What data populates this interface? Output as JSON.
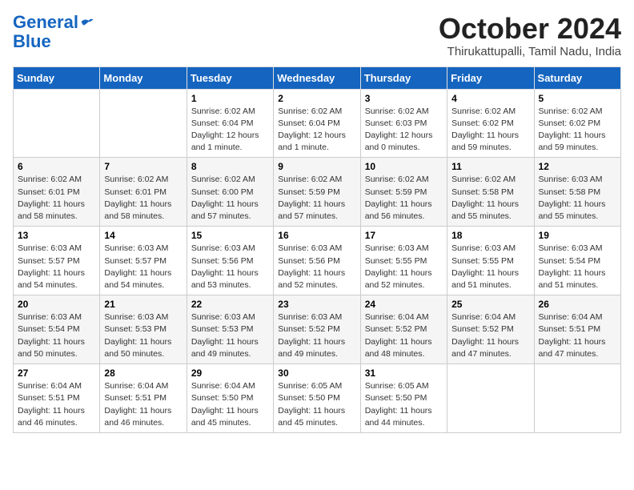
{
  "header": {
    "logo_line1": "General",
    "logo_line2": "Blue",
    "month": "October 2024",
    "location": "Thirukattupalli, Tamil Nadu, India"
  },
  "columns": [
    "Sunday",
    "Monday",
    "Tuesday",
    "Wednesday",
    "Thursday",
    "Friday",
    "Saturday"
  ],
  "weeks": [
    [
      {
        "day": "",
        "info": ""
      },
      {
        "day": "",
        "info": ""
      },
      {
        "day": "1",
        "info": "Sunrise: 6:02 AM\nSunset: 6:04 PM\nDaylight: 12 hours and 1 minute."
      },
      {
        "day": "2",
        "info": "Sunrise: 6:02 AM\nSunset: 6:04 PM\nDaylight: 12 hours and 1 minute."
      },
      {
        "day": "3",
        "info": "Sunrise: 6:02 AM\nSunset: 6:03 PM\nDaylight: 12 hours and 0 minutes."
      },
      {
        "day": "4",
        "info": "Sunrise: 6:02 AM\nSunset: 6:02 PM\nDaylight: 11 hours and 59 minutes."
      },
      {
        "day": "5",
        "info": "Sunrise: 6:02 AM\nSunset: 6:02 PM\nDaylight: 11 hours and 59 minutes."
      }
    ],
    [
      {
        "day": "6",
        "info": "Sunrise: 6:02 AM\nSunset: 6:01 PM\nDaylight: 11 hours and 58 minutes."
      },
      {
        "day": "7",
        "info": "Sunrise: 6:02 AM\nSunset: 6:01 PM\nDaylight: 11 hours and 58 minutes."
      },
      {
        "day": "8",
        "info": "Sunrise: 6:02 AM\nSunset: 6:00 PM\nDaylight: 11 hours and 57 minutes."
      },
      {
        "day": "9",
        "info": "Sunrise: 6:02 AM\nSunset: 5:59 PM\nDaylight: 11 hours and 57 minutes."
      },
      {
        "day": "10",
        "info": "Sunrise: 6:02 AM\nSunset: 5:59 PM\nDaylight: 11 hours and 56 minutes."
      },
      {
        "day": "11",
        "info": "Sunrise: 6:02 AM\nSunset: 5:58 PM\nDaylight: 11 hours and 55 minutes."
      },
      {
        "day": "12",
        "info": "Sunrise: 6:03 AM\nSunset: 5:58 PM\nDaylight: 11 hours and 55 minutes."
      }
    ],
    [
      {
        "day": "13",
        "info": "Sunrise: 6:03 AM\nSunset: 5:57 PM\nDaylight: 11 hours and 54 minutes."
      },
      {
        "day": "14",
        "info": "Sunrise: 6:03 AM\nSunset: 5:57 PM\nDaylight: 11 hours and 54 minutes."
      },
      {
        "day": "15",
        "info": "Sunrise: 6:03 AM\nSunset: 5:56 PM\nDaylight: 11 hours and 53 minutes."
      },
      {
        "day": "16",
        "info": "Sunrise: 6:03 AM\nSunset: 5:56 PM\nDaylight: 11 hours and 52 minutes."
      },
      {
        "day": "17",
        "info": "Sunrise: 6:03 AM\nSunset: 5:55 PM\nDaylight: 11 hours and 52 minutes."
      },
      {
        "day": "18",
        "info": "Sunrise: 6:03 AM\nSunset: 5:55 PM\nDaylight: 11 hours and 51 minutes."
      },
      {
        "day": "19",
        "info": "Sunrise: 6:03 AM\nSunset: 5:54 PM\nDaylight: 11 hours and 51 minutes."
      }
    ],
    [
      {
        "day": "20",
        "info": "Sunrise: 6:03 AM\nSunset: 5:54 PM\nDaylight: 11 hours and 50 minutes."
      },
      {
        "day": "21",
        "info": "Sunrise: 6:03 AM\nSunset: 5:53 PM\nDaylight: 11 hours and 50 minutes."
      },
      {
        "day": "22",
        "info": "Sunrise: 6:03 AM\nSunset: 5:53 PM\nDaylight: 11 hours and 49 minutes."
      },
      {
        "day": "23",
        "info": "Sunrise: 6:03 AM\nSunset: 5:52 PM\nDaylight: 11 hours and 49 minutes."
      },
      {
        "day": "24",
        "info": "Sunrise: 6:04 AM\nSunset: 5:52 PM\nDaylight: 11 hours and 48 minutes."
      },
      {
        "day": "25",
        "info": "Sunrise: 6:04 AM\nSunset: 5:52 PM\nDaylight: 11 hours and 47 minutes."
      },
      {
        "day": "26",
        "info": "Sunrise: 6:04 AM\nSunset: 5:51 PM\nDaylight: 11 hours and 47 minutes."
      }
    ],
    [
      {
        "day": "27",
        "info": "Sunrise: 6:04 AM\nSunset: 5:51 PM\nDaylight: 11 hours and 46 minutes."
      },
      {
        "day": "28",
        "info": "Sunrise: 6:04 AM\nSunset: 5:51 PM\nDaylight: 11 hours and 46 minutes."
      },
      {
        "day": "29",
        "info": "Sunrise: 6:04 AM\nSunset: 5:50 PM\nDaylight: 11 hours and 45 minutes."
      },
      {
        "day": "30",
        "info": "Sunrise: 6:05 AM\nSunset: 5:50 PM\nDaylight: 11 hours and 45 minutes."
      },
      {
        "day": "31",
        "info": "Sunrise: 6:05 AM\nSunset: 5:50 PM\nDaylight: 11 hours and 44 minutes."
      },
      {
        "day": "",
        "info": ""
      },
      {
        "day": "",
        "info": ""
      }
    ]
  ]
}
